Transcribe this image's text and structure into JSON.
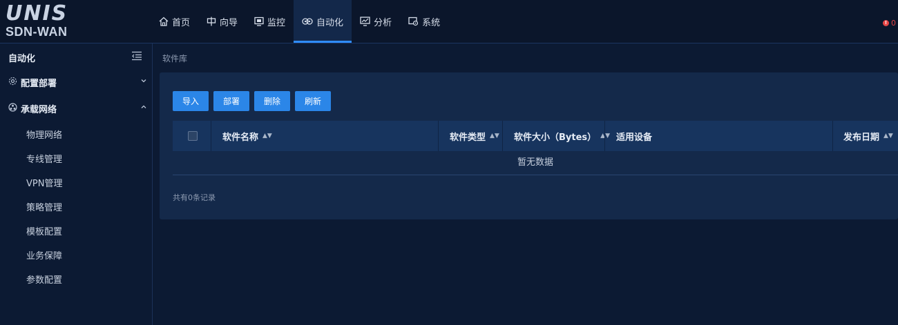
{
  "logo": {
    "top": "UNIS",
    "bottom": "SDN-WAN"
  },
  "nav": {
    "items": [
      {
        "label": "首页",
        "icon": "home-icon"
      },
      {
        "label": "向导",
        "icon": "guide-icon"
      },
      {
        "label": "监控",
        "icon": "monitor-icon"
      },
      {
        "label": "自动化",
        "icon": "automation-icon",
        "active": true
      },
      {
        "label": "分析",
        "icon": "analysis-icon"
      },
      {
        "label": "系统",
        "icon": "system-icon"
      }
    ],
    "alert_count": "0"
  },
  "sidebar": {
    "title": "自动化",
    "groups": [
      {
        "label": "配置部署",
        "icon": "gear-icon",
        "expanded": false
      },
      {
        "label": "承载网络",
        "icon": "network-icon",
        "expanded": true
      }
    ],
    "items": [
      "物理网络",
      "专线管理",
      "VPN管理",
      "策略管理",
      "模板配置",
      "业务保障",
      "参数配置"
    ]
  },
  "breadcrumb": "软件库",
  "toolbar": {
    "import": "导入",
    "deploy": "部署",
    "delete": "删除",
    "refresh": "刷新"
  },
  "table": {
    "columns": [
      "软件名称",
      "软件类型",
      "软件大小（Bytes）",
      "适用设备",
      "发布日期"
    ],
    "empty_text": "暂无数据",
    "total_text": "共有0条记录"
  },
  "colors": {
    "accent": "#2f8cff",
    "button": "#2b86e8",
    "background": "#0c1a33",
    "panel": "#14294a"
  }
}
